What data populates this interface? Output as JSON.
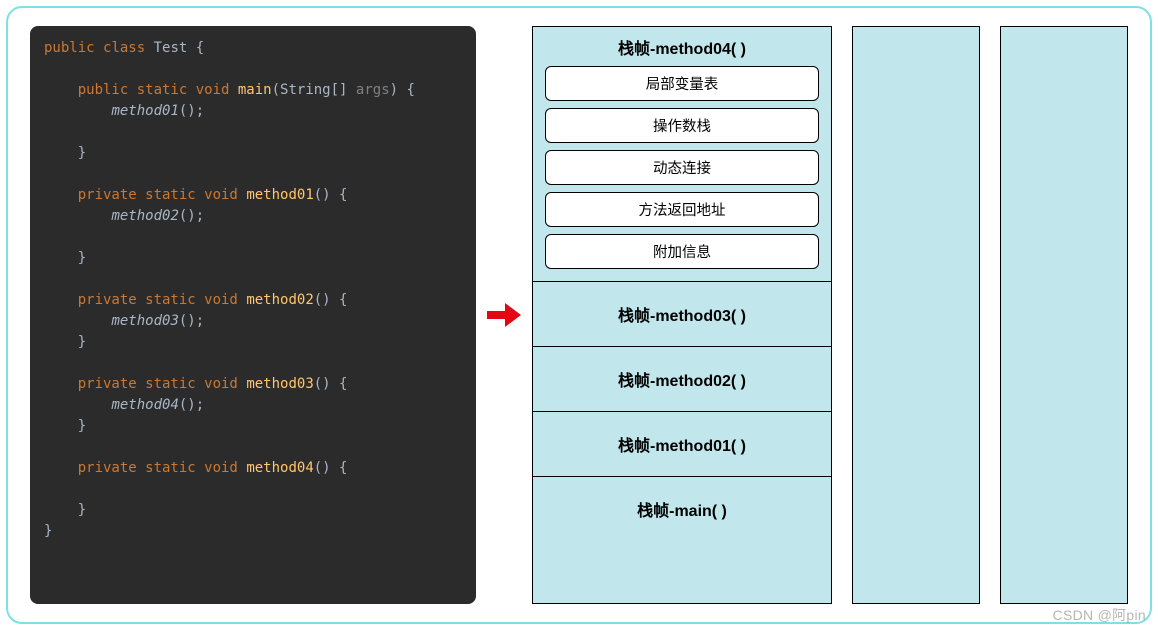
{
  "code": {
    "tokens": [
      [
        [
          "public",
          "kw"
        ],
        [
          " ",
          "p"
        ],
        [
          "class",
          "kw"
        ],
        [
          " ",
          "p"
        ],
        [
          "Test",
          "type"
        ],
        [
          " {",
          "p"
        ]
      ],
      [],
      [
        [
          "    ",
          "p"
        ],
        [
          "public static void",
          "kw"
        ],
        [
          " ",
          "p"
        ],
        [
          "main",
          "id"
        ],
        [
          "(",
          "p"
        ],
        [
          "String",
          "type"
        ],
        [
          "[] ",
          "p"
        ],
        [
          "args",
          "gray"
        ],
        [
          ") {",
          "p"
        ]
      ],
      [
        [
          "        ",
          "p"
        ],
        [
          "method01",
          "call"
        ],
        [
          "();",
          "p"
        ]
      ],
      [],
      [
        [
          "    }",
          "p"
        ]
      ],
      [],
      [
        [
          "    ",
          "p"
        ],
        [
          "private static void",
          "kw"
        ],
        [
          " ",
          "p"
        ],
        [
          "method01",
          "id"
        ],
        [
          "() {",
          "p"
        ]
      ],
      [
        [
          "        ",
          "p"
        ],
        [
          "method02",
          "call"
        ],
        [
          "();",
          "p"
        ]
      ],
      [],
      [
        [
          "    }",
          "p"
        ]
      ],
      [],
      [
        [
          "    ",
          "p"
        ],
        [
          "private static void",
          "kw"
        ],
        [
          " ",
          "p"
        ],
        [
          "method02",
          "id"
        ],
        [
          "() {",
          "p"
        ]
      ],
      [
        [
          "        ",
          "p"
        ],
        [
          "method03",
          "call"
        ],
        [
          "();",
          "p"
        ]
      ],
      [
        [
          "    }",
          "p"
        ]
      ],
      [],
      [
        [
          "    ",
          "p"
        ],
        [
          "private static void",
          "kw"
        ],
        [
          " ",
          "p"
        ],
        [
          "method03",
          "id"
        ],
        [
          "() {",
          "p"
        ]
      ],
      [
        [
          "        ",
          "p"
        ],
        [
          "method04",
          "call"
        ],
        [
          "();",
          "p"
        ]
      ],
      [
        [
          "    }",
          "p"
        ]
      ],
      [],
      [
        [
          "    ",
          "p"
        ],
        [
          "private static void",
          "kw"
        ],
        [
          " ",
          "p"
        ],
        [
          "method04",
          "id"
        ],
        [
          "() {",
          "p"
        ]
      ],
      [],
      [
        [
          "    }",
          "p"
        ]
      ],
      [
        [
          "}",
          "p"
        ]
      ]
    ]
  },
  "stack": {
    "top_frame": {
      "title": "栈帧-method04( )",
      "parts": [
        "局部变量表",
        "操作数栈",
        "动态连接",
        "方法返回地址",
        "附加信息"
      ]
    },
    "frames": [
      "栈帧-method03( )",
      "栈帧-method02( )",
      "栈帧-method01( )",
      "栈帧-main( )"
    ]
  },
  "watermark": "CSDN @阿pin"
}
